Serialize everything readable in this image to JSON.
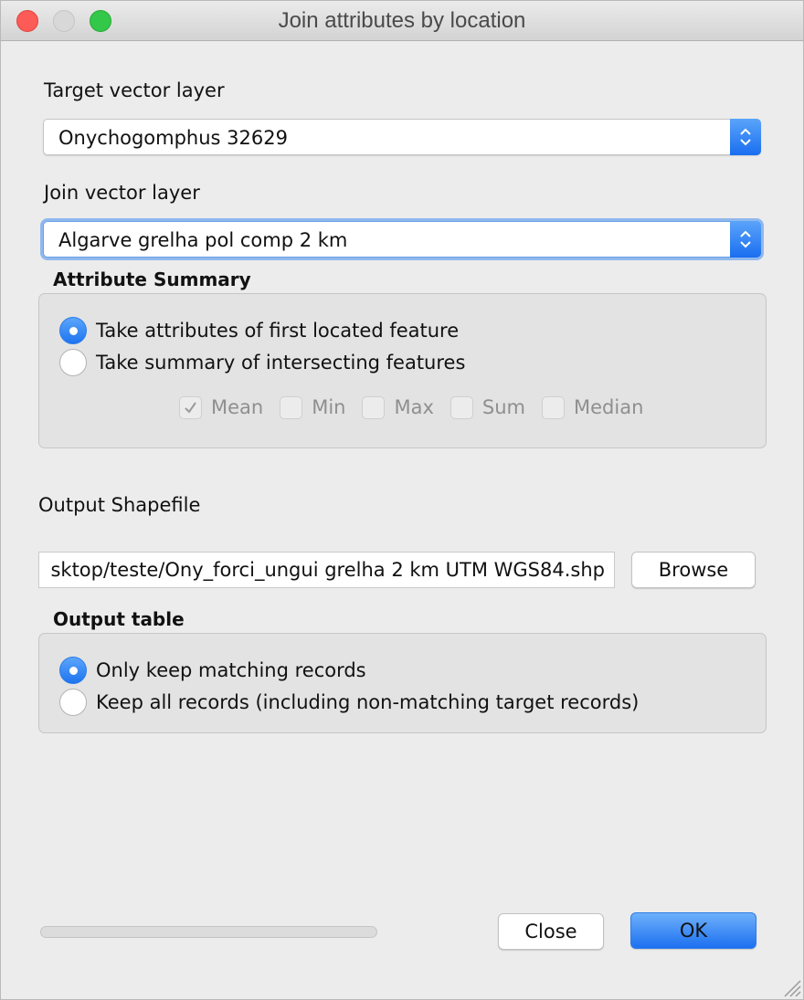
{
  "window": {
    "title": "Join attributes by location",
    "controls": [
      "close",
      "minimize",
      "zoom"
    ]
  },
  "target_layer": {
    "label": "Target vector layer",
    "selected": "Onychogomphus 32629"
  },
  "join_layer": {
    "label": "Join vector layer",
    "selected": "Algarve grelha pol comp 2 km",
    "focused": true
  },
  "attribute_summary": {
    "title": "Attribute Summary",
    "options": [
      {
        "label": "Take attributes of first located feature",
        "checked": true
      },
      {
        "label": "Take summary of intersecting features",
        "checked": false
      }
    ],
    "statistics": [
      {
        "label": "Mean",
        "checked": true,
        "enabled": false
      },
      {
        "label": "Min",
        "checked": false,
        "enabled": false
      },
      {
        "label": "Max",
        "checked": false,
        "enabled": false
      },
      {
        "label": "Sum",
        "checked": false,
        "enabled": false
      },
      {
        "label": "Median",
        "checked": false,
        "enabled": false
      }
    ]
  },
  "output_shapefile": {
    "label": "Output Shapefile",
    "value": "sktop/teste/Ony_forci_ungui grelha 2 km UTM WGS84.shp",
    "browse_label": "Browse"
  },
  "output_table": {
    "title": "Output table",
    "options": [
      {
        "label": "Only keep matching records",
        "checked": true
      },
      {
        "label": "Keep all records (including non-matching target records)",
        "checked": false
      }
    ]
  },
  "footer": {
    "progress_percent": 0,
    "close_label": "Close",
    "ok_label": "OK"
  },
  "colors": {
    "accent": "#1e74f0",
    "close_light": "#fc5b57",
    "zoom_light": "#34c84a"
  }
}
